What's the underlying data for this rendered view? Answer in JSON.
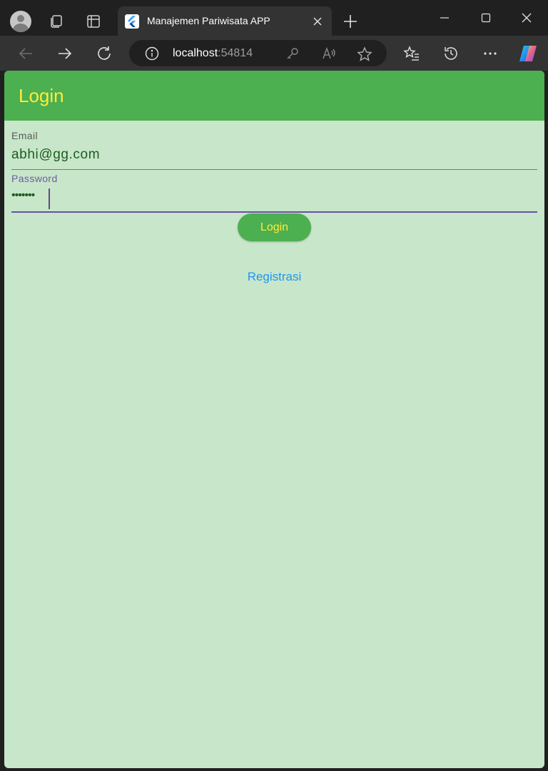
{
  "browser": {
    "tab_title": "Manajemen Pariwisata APP",
    "url_host": "localhost",
    "url_port": ":54814"
  },
  "app": {
    "title": "Login",
    "email_label": "Email",
    "email_value": "abhi@gg.com",
    "password_label": "Password",
    "password_value": "•••••••",
    "login_button": "Login",
    "register_link": "Registrasi"
  },
  "colors": {
    "appbar": "#4caf50",
    "title_text": "#ffeb3b",
    "page_bg": "#c8e6c9",
    "link": "#2196f3",
    "focus": "#6750a4"
  }
}
